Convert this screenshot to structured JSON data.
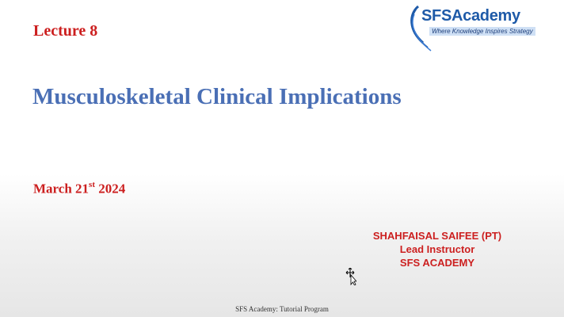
{
  "slide": {
    "lecture_label": "Lecture 8",
    "title": "Musculoskeletal Clinical Implications",
    "date_prefix": "March 21",
    "date_suffix": "st",
    "date_year": " 2024",
    "instructor": {
      "name": "SHAHFAISAL SAIFEE (PT)",
      "role": "Lead Instructor",
      "org": "SFS ACADEMY"
    },
    "footer": "SFS Academy: Tutorial Program"
  },
  "logo": {
    "name_part1": "SFS",
    "name_part2": "Academy",
    "tagline": "Where Knowledge Inspires Strategy",
    "brand_color": "#1e5aa8"
  },
  "colors": {
    "accent_red": "#cc1f1f",
    "title_blue": "#4a6fb5"
  },
  "cursor": {
    "icon": "move-cursor-icon"
  }
}
